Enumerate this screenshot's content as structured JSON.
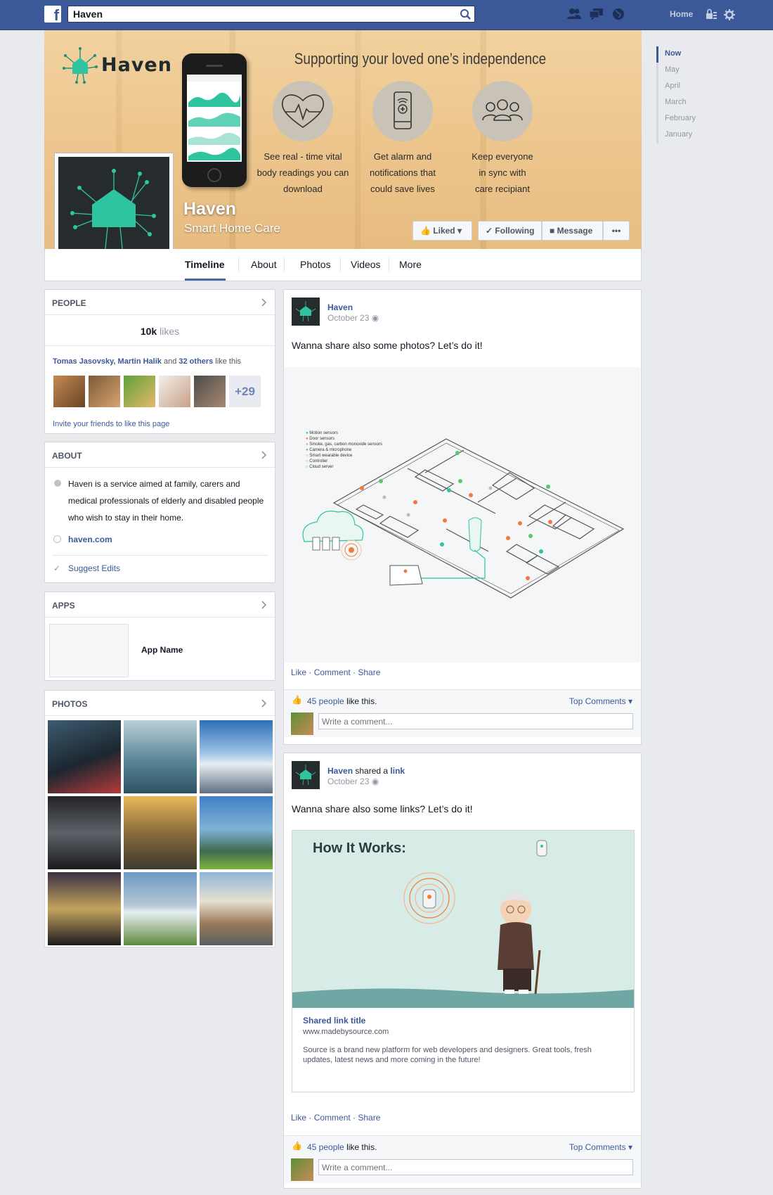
{
  "topbar": {
    "search_value": "Haven",
    "home_label": "Home"
  },
  "cover": {
    "brand": "Haven",
    "tagline": "Supporting your loved one’s independence",
    "features": [
      {
        "lines": [
          "See real - time vital",
          "body readings you can",
          "download"
        ],
        "icon": "heartbeat-icon"
      },
      {
        "lines": [
          "Get alarm and",
          "notifications that",
          "could save lives"
        ],
        "icon": "phone-alert-icon"
      },
      {
        "lines": [
          "Keep everyone",
          "in sync with",
          "care recipiant"
        ],
        "icon": "group-icon"
      }
    ],
    "page_name": "Haven",
    "page_subtitle": "Smart Home Care",
    "buttons": {
      "liked": "Liked",
      "following": "Following",
      "message": "Message",
      "more": "•••"
    }
  },
  "tabs": [
    "Timeline",
    "About",
    "Photos",
    "Videos",
    "More"
  ],
  "scrubber": [
    "Now",
    "May",
    "April",
    "March",
    "February",
    "January"
  ],
  "people": {
    "title": "PEOPLE",
    "likes_count": "10k",
    "likes_word": "likes",
    "friends": [
      "Tomas Jasovsky",
      "Martin Halik"
    ],
    "and_word": "and",
    "others": "32 others",
    "like_this": "like this",
    "more_count": "+29",
    "invite": "Invite your friends to like this page"
  },
  "about": {
    "title": "ABOUT",
    "description": "Haven is a service aimed at family, carers and medical professionals of elderly and disabled people who wish to stay in their home.",
    "website": "haven.com",
    "suggest": "Suggest Edits"
  },
  "apps": {
    "title": "APPS",
    "app_name": "App Name"
  },
  "photos": {
    "title": "PHOTOS"
  },
  "posts": [
    {
      "author": "Haven",
      "date": "October 23",
      "text": "Wanna share also some photos? Let’s do it!",
      "legend": [
        "Motion sensors",
        "Door sensors",
        "Smoke, gas, carbon monoxide sensors",
        "Camera & microphone",
        "Smart wearable device",
        "Controller",
        "Cloud server"
      ],
      "actions": [
        "Like",
        "Comment",
        "Share"
      ],
      "likes_link": "45 people",
      "likes_rest": "like this.",
      "top_comments": "Top Comments",
      "comment_placeholder": "Write a comment..."
    },
    {
      "author": "Haven",
      "shared_word": "shared a",
      "link_word": "link",
      "date": "October 23",
      "text": "Wanna share also some links? Let’s do it!",
      "image_heading": "How It Works:",
      "link_title": "Shared link title",
      "link_url": "www.madebysource.com",
      "link_desc": "Source is a brand new platform for web developers and designers. Great tools, fresh updates, latest news and more coming in the future!",
      "actions": [
        "Like",
        "Comment",
        "Share"
      ],
      "likes_link": "45 people",
      "likes_rest": "like this.",
      "top_comments": "Top Comments",
      "comment_placeholder": "Write a comment..."
    }
  ],
  "colors": {
    "fb_blue": "#3b5998",
    "teal": "#2ec4a0",
    "orange": "#f07b3f",
    "dark": "#262c2d"
  }
}
